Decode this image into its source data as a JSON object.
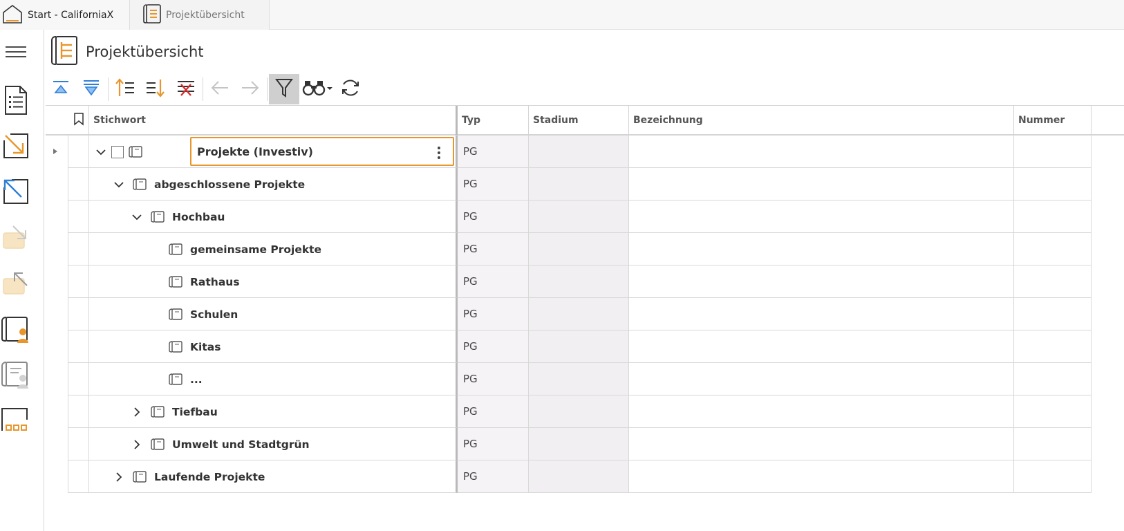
{
  "tabs": [
    {
      "label": "Start - CaliforniaX",
      "icon": "home-icon"
    },
    {
      "label": "Projektübersicht",
      "icon": "project-book-icon"
    }
  ],
  "header": {
    "title": "Projektübersicht",
    "icon": "project-book-icon"
  },
  "leftbar": {
    "items": [
      {
        "name": "menu-icon"
      },
      {
        "name": "document-list-icon"
      },
      {
        "name": "import-icon"
      },
      {
        "name": "export-icon"
      },
      {
        "name": "import-disabled-icon"
      },
      {
        "name": "export-disabled-icon"
      },
      {
        "name": "project-user-icon"
      },
      {
        "name": "project-user-disabled-icon"
      },
      {
        "name": "folder-dots-icon"
      }
    ]
  },
  "toolbar": {
    "buttons": [
      "collapse-all-icon",
      "expand-all-icon",
      "move-up-icon",
      "move-down-icon",
      "remove-sort-icon",
      "back-arrow-icon",
      "forward-arrow-icon",
      "filter-icon",
      "search-binoculars-icon",
      "refresh-icon"
    ],
    "filter_active": true
  },
  "grid": {
    "columns": {
      "stichwort": "Stichwort",
      "typ": "Typ",
      "stadium": "Stadium",
      "bezeichnung": "Bezeichnung",
      "nummer": "Nummer"
    },
    "rows": [
      {
        "keyword": "Projekte (Investiv)",
        "typ": "PG",
        "level": 0,
        "expander": "down",
        "selected": true
      },
      {
        "keyword": "abgeschlossene Projekte",
        "typ": "PG",
        "level": 1,
        "expander": "down"
      },
      {
        "keyword": "Hochbau",
        "typ": "PG",
        "level": 2,
        "expander": "down"
      },
      {
        "keyword": "gemeinsame Projekte",
        "typ": "PG",
        "level": 3,
        "expander": "none"
      },
      {
        "keyword": "Rathaus",
        "typ": "PG",
        "level": 3,
        "expander": "none"
      },
      {
        "keyword": "Schulen",
        "typ": "PG",
        "level": 3,
        "expander": "none"
      },
      {
        "keyword": "Kitas",
        "typ": "PG",
        "level": 3,
        "expander": "none"
      },
      {
        "keyword": "...",
        "typ": "PG",
        "level": 3,
        "expander": "none"
      },
      {
        "keyword": "Tiefbau",
        "typ": "PG",
        "level": 2,
        "expander": "right"
      },
      {
        "keyword": "Umwelt und Stadtgrün",
        "typ": "PG",
        "level": 2,
        "expander": "right"
      },
      {
        "keyword": "Laufende Projekte",
        "typ": "PG",
        "level": 1,
        "expander": "right"
      }
    ]
  },
  "colors": {
    "accent": "#e8962b",
    "blue": "#2f7fd6",
    "disabled": "#f1d9ad"
  }
}
